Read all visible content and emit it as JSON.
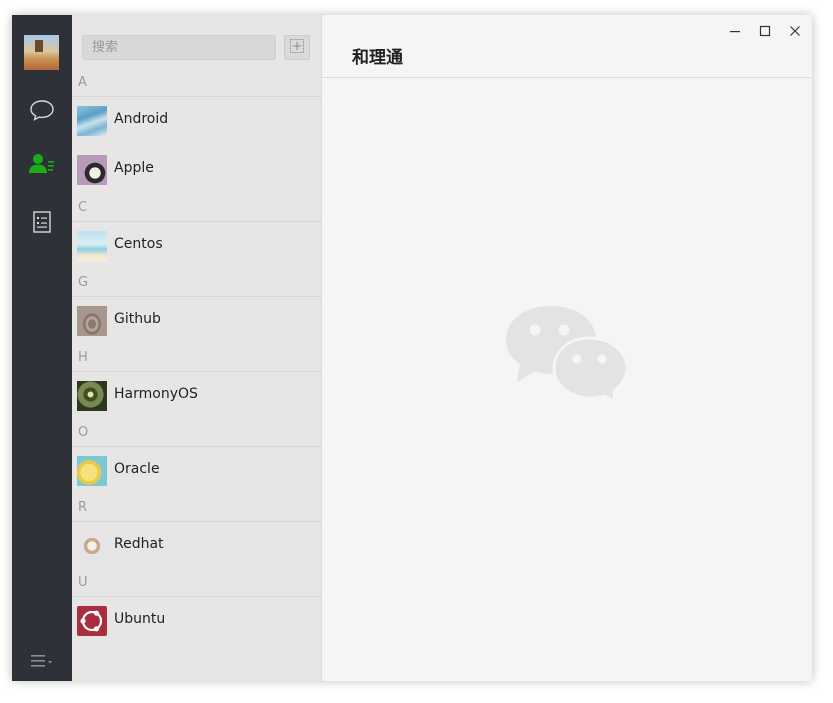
{
  "search": {
    "placeholder": "搜索"
  },
  "header": {
    "title": "和理通"
  },
  "groups": [
    {
      "letter": "A",
      "contacts": [
        {
          "name": "Android",
          "avatar": "blue-water-thumb"
        },
        {
          "name": "Apple",
          "avatar": "dog-thumb"
        }
      ]
    },
    {
      "letter": "C",
      "contacts": [
        {
          "name": "Centos",
          "avatar": "beach-thumb"
        }
      ]
    },
    {
      "letter": "G",
      "contacts": [
        {
          "name": "Github",
          "avatar": "sand-thumb"
        }
      ]
    },
    {
      "letter": "H",
      "contacts": [
        {
          "name": "HarmonyOS",
          "avatar": "plant-thumb"
        }
      ]
    },
    {
      "letter": "O",
      "contacts": [
        {
          "name": "Oracle",
          "avatar": "pikachu-thumb"
        }
      ]
    },
    {
      "letter": "R",
      "contacts": [
        {
          "name": "Redhat",
          "avatar": "puppy-thumb"
        }
      ]
    },
    {
      "letter": "U",
      "contacts": [
        {
          "name": "Ubuntu",
          "avatar": "ubuntu-logo"
        }
      ]
    }
  ],
  "nav": {
    "items": [
      {
        "icon": "chat-bubble-icon",
        "active": false
      },
      {
        "icon": "contacts-icon",
        "active": true
      },
      {
        "icon": "notes-icon",
        "active": false
      }
    ],
    "menu_icon": "hamburger-menu-icon"
  },
  "colors": {
    "rail_bg": "#2e3238",
    "accent": "#1aad19",
    "contacts_bg": "#e8e6e4",
    "main_bg": "#f5f5f5"
  }
}
